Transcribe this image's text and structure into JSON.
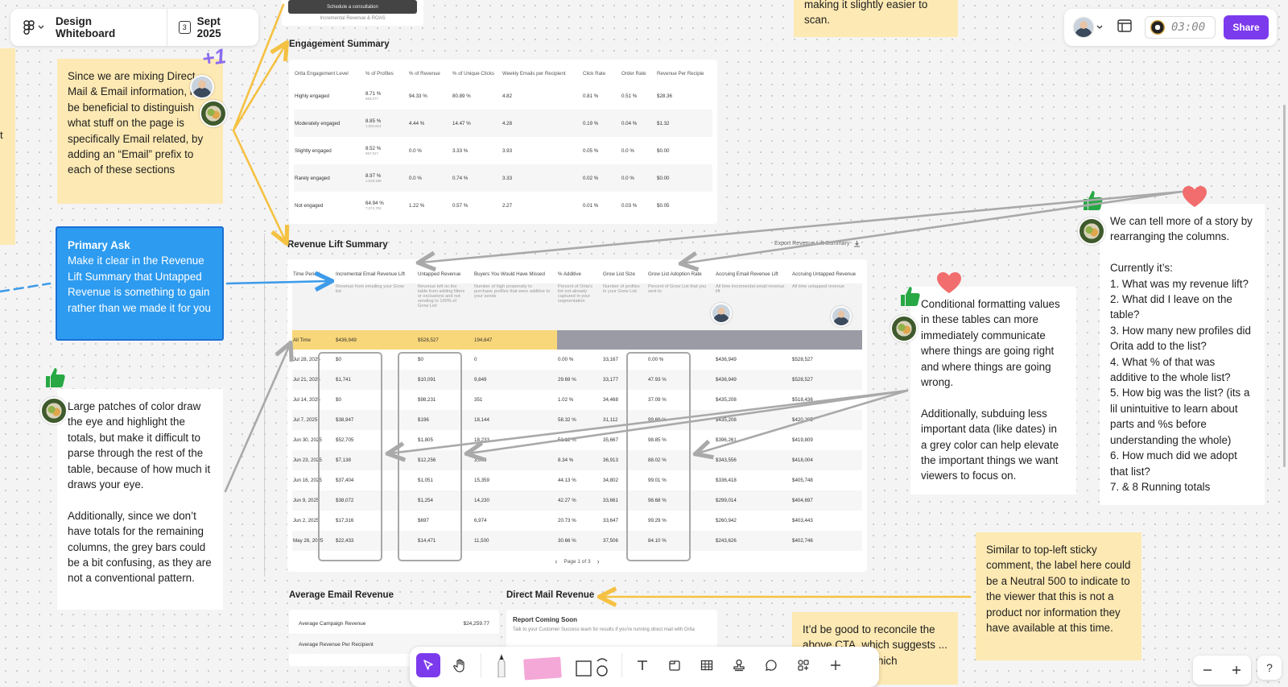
{
  "header": {
    "file_name": "Design Whiteboard",
    "page_badge": "3",
    "page_name": "Sept 2025"
  },
  "top_right": {
    "timer": "03:00",
    "share_label": "Share"
  },
  "top_snippets": {
    "cta_button": "Schedule a consultation",
    "cta_sub": "Incremental Revenue & ROAS",
    "right_sticky": "making it slightly easier to scan."
  },
  "engagement": {
    "title": "Engagement Summary",
    "columns": [
      "Orita Engagement Level",
      "% of Profiles",
      "% of Revenue",
      "% of Unique Clicks",
      "Weekly Emails per Recipient",
      "Click Rate",
      "Order Rate",
      "Revenue Per Recipie"
    ],
    "rows": [
      {
        "c0": "Highly engaged",
        "c1": "8.71 %",
        "c1s": "883,577",
        "c2": "94.33 %",
        "c3": "80.89 %",
        "c4": "4.82",
        "c5": "0.81 %",
        "c6": "0.51 %",
        "c7": "$28.36"
      },
      {
        "c0": "Moderately engaged",
        "c1": "8.85 %",
        "c1s": "1,004,614",
        "c2": "4.44 %",
        "c3": "14.47 %",
        "c4": "4.28",
        "c5": "0.19 %",
        "c6": "0.04 %",
        "c7": "$1.32"
      },
      {
        "c0": "Slightly engaged",
        "c1": "8.52 %",
        "c1s": "967,917",
        "c2": "0.0 %",
        "c3": "3.33 %",
        "c4": "3.93",
        "c5": "0.05 %",
        "c6": "0.0 %",
        "c7": "$0.00"
      },
      {
        "c0": "Rarely engaged",
        "c1": "8.97 %",
        "c1s": "1,019,198",
        "c2": "0.0 %",
        "c3": "0.74 %",
        "c4": "3.33",
        "c5": "0.02 %",
        "c6": "0.0 %",
        "c7": "$0.00"
      },
      {
        "c0": "Not engaged",
        "c1": "64.94 %",
        "c1s": "7,374,702",
        "c2": "1.22 %",
        "c3": "0.57 %",
        "c4": "2.27",
        "c5": "0.01 %",
        "c6": "0.03 %",
        "c7": "$0.05"
      }
    ]
  },
  "revenue_lift": {
    "title": "Revenue Lift Summary",
    "export_label": "Export Revenue Lift Summary",
    "columns": [
      "Time Period",
      "Incremental Email Revenue Lift",
      "Untapped Revenue",
      "Buyers You Would Have Missed",
      "% Additive",
      "Grow List Size",
      "Grow List Adoption Rate",
      "Accruing Email Revenue Lift",
      "Accruing Untapped Revenue"
    ],
    "descriptions": [
      "",
      "Revenue from emailing your Grow list",
      "Revenue left on the table from adding filters or exclusions and not sending to 100% of Grow List",
      "Number of high propensity to purchase profiles that were additive to your sends",
      "Percent of Orita's list not already captured in your segmentation",
      "Number of profiles in your Grow List",
      "Percent of Grow List that you sent to",
      "All time incremental email revenue lift",
      "All time untapped revenue"
    ],
    "all_time": {
      "label": "All Time",
      "c1": "$436,949",
      "c2": "$528,527",
      "c3": "194,647"
    },
    "rows": [
      {
        "d": "Jul 28, 2025",
        "a": "$0",
        "b": "$0",
        "c": "0",
        "p": "0.00 %",
        "g": "33,167",
        "r": "0.00 %",
        "e": "$436,949",
        "u": "$528,527"
      },
      {
        "d": "Jul 21, 2025",
        "a": "$1,741",
        "b": "$10,091",
        "c": "9,849",
        "p": "29.69 %",
        "g": "33,177",
        "r": "47.93 %",
        "e": "$436,949",
        "u": "$528,527"
      },
      {
        "d": "Jul 14, 2025",
        "a": "$0",
        "b": "$98,231",
        "c": "351",
        "p": "1.02 %",
        "g": "34,468",
        "r": "37.09 %",
        "e": "$435,208",
        "u": "$518,436"
      },
      {
        "d": "Jul 7, 2025",
        "a": "$38,947",
        "b": "$196",
        "c": "18,144",
        "p": "58.32 %",
        "g": "31,112",
        "r": "99.69 %",
        "e": "$435,208",
        "u": "$420,205"
      },
      {
        "d": "Jun 30, 2025",
        "a": "$52,705",
        "b": "$1,805",
        "c": "18,233",
        "p": "51.12 %",
        "g": "35,667",
        "r": "98.85 %",
        "e": "$396,261",
        "u": "$419,809"
      },
      {
        "d": "Jun 23, 2025",
        "a": "$7,138",
        "b": "$12,256",
        "c": "3,079",
        "p": "8.34 %",
        "g": "36,913",
        "r": "88.02 %",
        "e": "$343,556",
        "u": "$418,004"
      },
      {
        "d": "Jun 16, 2025",
        "a": "$37,404",
        "b": "$1,051",
        "c": "15,359",
        "p": "44.13 %",
        "g": "34,802",
        "r": "99.01 %",
        "e": "$336,418",
        "u": "$405,748"
      },
      {
        "d": "Jun 9, 2025",
        "a": "$38,072",
        "b": "$1,254",
        "c": "14,230",
        "p": "42.27 %",
        "g": "33,661",
        "r": "98.68 %",
        "e": "$299,014",
        "u": "$404,697"
      },
      {
        "d": "Jun 2, 2025",
        "a": "$17,316",
        "b": "$697",
        "c": "6,974",
        "p": "20.73 %",
        "g": "33,647",
        "r": "99.29 %",
        "e": "$260,942",
        "u": "$403,443"
      },
      {
        "d": "May 26, 2025",
        "a": "$22,433",
        "b": "$14,471",
        "c": "11,500",
        "p": "30.66 %",
        "g": "37,506",
        "r": "84.10 %",
        "e": "$243,626",
        "u": "$402,746"
      }
    ],
    "pager": "Page 1 of 3"
  },
  "avg_email": {
    "title": "Average Email Revenue",
    "r1_label": "Average Campaign Revenue",
    "r1_value": "$24,259.77",
    "r2_label": "Average Revenue Per Recipient"
  },
  "direct_mail": {
    "title": "Direct Mail Revenue",
    "heading": "Report Coming Soon",
    "sub": "Talk to your Customer Success team for results if you're running direct mail with Orita"
  },
  "stickies": {
    "mixing": "Since we are mixing Direct Mail & Email information, may be beneficial to distinguish what stuff on the page is specifically Email related, by adding an “Email” prefix to each of these sections",
    "plus_one": "+1",
    "primary_title": "Primary Ask",
    "primary_body": "Make it clear in the Revenue Lift Summary that Untapped Revenue is something to gain rather than we made it for you",
    "patches": "Large patches of color draw the eye and highlight the totals, but make it difficult to parse through the rest of the table, because of how much it draws your eye.\n\nAdditionally, since we don’t have totals for the remaining columns, the grey bars could be a bit confusing, as they are not a conventional pattern.",
    "conditional": "Conditional formatting values in these tables can more immediately communicate where things are going right and where things are going wrong.\n\nAdditionally, subduing less important data (like dates) in a grey color can help elevate the important things we want viewers to focus on.",
    "story": "We can tell more of a story by rearranging the columns.\n\nCurrently it’s:\n1. What was my revenue lift?\n2. What did I leave on the table?\n3. How many new profiles did Orita add to the list?\n4. What % of that was additive to the whole list?\n5. How big was the list? (its a lil unintuitive to learn about parts and %s before understanding the whole)\n6. How much did we adopt that list?\n7. & 8 Running totals",
    "similar": "Similar to top-left sticky comment, the label here could be a Neutral 500 to indicate to the viewer that this is not a product nor information they have available at this time.",
    "reconcile": "It’d be good to reconcile the above CTA, which suggests ... direct mail, ... which"
  },
  "colors": {
    "accent": "#7c3aed",
    "sticky_yellow": "#fde9b3",
    "ask_blue": "#2d9bf0",
    "arrow_yellow": "#f5c142",
    "arrow_grey": "#a9a9a9",
    "arrow_blue": "#3d9be9",
    "thumb_green": "#27a844",
    "heart_red": "#f26d6d",
    "all_time_yellow": "#f8d77a",
    "all_time_grey": "#9b9ba6"
  }
}
